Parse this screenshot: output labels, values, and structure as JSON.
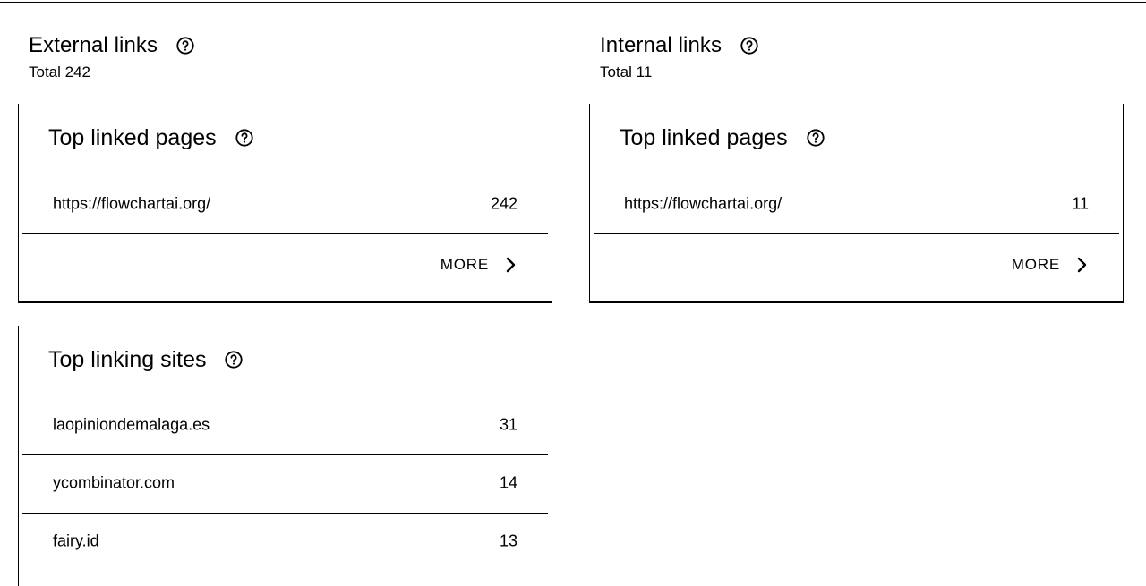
{
  "external": {
    "title": "External links",
    "total": "Total 242",
    "top_linked_pages": {
      "title": "Top linked pages",
      "rows": [
        {
          "label": "https://flowchartai.org/",
          "count": "242"
        }
      ],
      "more_label": "MORE"
    },
    "top_linking_sites": {
      "title": "Top linking sites",
      "rows": [
        {
          "label": "laopiniondemalaga.es",
          "count": "31"
        },
        {
          "label": "ycombinator.com",
          "count": "14"
        },
        {
          "label": "fairy.id",
          "count": "13"
        }
      ]
    }
  },
  "internal": {
    "title": "Internal links",
    "total": "Total 11",
    "top_linked_pages": {
      "title": "Top linked pages",
      "rows": [
        {
          "label": "https://flowchartai.org/",
          "count": "11"
        }
      ],
      "more_label": "MORE"
    }
  },
  "icons": {
    "help": "help-circle-icon",
    "more": "chevron-right-icon"
  }
}
